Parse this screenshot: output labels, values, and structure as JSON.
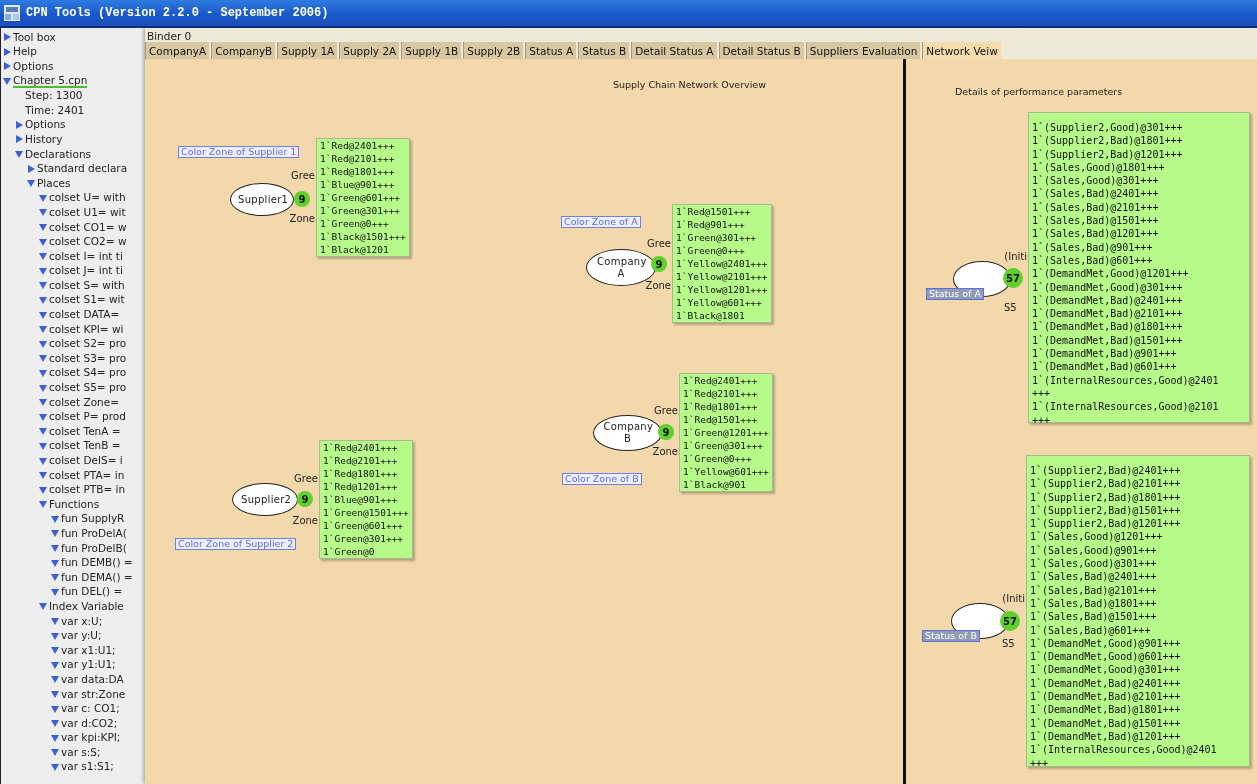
{
  "window": {
    "title": "CPN Tools (Version 2.2.0 - September 2006)"
  },
  "sidebar": {
    "items": [
      {
        "label": "Tool box",
        "expanded": false,
        "selected": false
      },
      {
        "label": "Help",
        "expanded": false,
        "selected": false
      },
      {
        "label": "Options",
        "expanded": false,
        "selected": false
      },
      {
        "label": "Chapter 5.cpn",
        "expanded": true,
        "selected": true,
        "children": [
          {
            "label": "Step: 1300"
          },
          {
            "label": "Time: 2401"
          },
          {
            "label": "Options",
            "expanded": false
          },
          {
            "label": "History",
            "expanded": false
          },
          {
            "label": "Declarations",
            "expanded": true,
            "children": [
              {
                "label": "Standard declara",
                "expanded": false
              },
              {
                "label": "Places",
                "expanded": true,
                "children": [
                  {
                    "label": "colset U= with",
                    "expanded": true
                  },
                  {
                    "label": "colset U1= wit",
                    "expanded": true
                  },
                  {
                    "label": "colset CO1= w",
                    "expanded": true
                  },
                  {
                    "label": "colset CO2= w",
                    "expanded": true
                  },
                  {
                    "label": "colset I= int ti",
                    "expanded": true
                  },
                  {
                    "label": "colset J= int ti",
                    "expanded": true
                  },
                  {
                    "label": "colset S= with",
                    "expanded": true
                  },
                  {
                    "label": "colset S1= wit",
                    "expanded": true
                  },
                  {
                    "label": "colset DATA=",
                    "expanded": true
                  },
                  {
                    "label": "colset KPI= wi",
                    "expanded": true
                  },
                  {
                    "label": "colset S2= pro",
                    "expanded": true
                  },
                  {
                    "label": "colset S3= pro",
                    "expanded": true
                  },
                  {
                    "label": "colset S4= pro",
                    "expanded": true
                  },
                  {
                    "label": "colset S5= pro",
                    "expanded": true
                  },
                  {
                    "label": "colset Zone=",
                    "expanded": true
                  },
                  {
                    "label": "colset P= prod",
                    "expanded": true
                  },
                  {
                    "label": "colset TenA =",
                    "expanded": true
                  },
                  {
                    "label": "colset TenB =",
                    "expanded": true
                  },
                  {
                    "label": "colset DelS= i",
                    "expanded": true
                  },
                  {
                    "label": "colset PTA= in",
                    "expanded": true
                  },
                  {
                    "label": "colset PTB= in",
                    "expanded": true
                  },
                  {
                    "label": "Functions",
                    "expanded": true,
                    "children": [
                      {
                        "label": "fun SupplyR",
                        "expanded": true
                      },
                      {
                        "label": "fun ProDelA(",
                        "expanded": true
                      },
                      {
                        "label": "fun ProDelB(",
                        "expanded": true
                      },
                      {
                        "label": "fun DEMB() =",
                        "expanded": true
                      },
                      {
                        "label": "fun DEMA() =",
                        "expanded": true
                      },
                      {
                        "label": "fun DEL() =",
                        "expanded": true
                      }
                    ]
                  },
                  {
                    "label": "Index Variable",
                    "expanded": true,
                    "children": [
                      {
                        "label": "var x:U;",
                        "expanded": true
                      },
                      {
                        "label": "var y:U;",
                        "expanded": true
                      },
                      {
                        "label": "var x1:U1;",
                        "expanded": true
                      },
                      {
                        "label": "var y1:U1;",
                        "expanded": true
                      },
                      {
                        "label": "var data:DA",
                        "expanded": true
                      },
                      {
                        "label": "var str:Zone",
                        "expanded": true
                      },
                      {
                        "label": "var c: CO1;",
                        "expanded": true
                      },
                      {
                        "label": "var d:CO2;",
                        "expanded": true
                      },
                      {
                        "label": "var kpi:KPI;",
                        "expanded": true
                      },
                      {
                        "label": "var s:S;",
                        "expanded": true
                      },
                      {
                        "label": "var s1:S1;",
                        "expanded": true
                      }
                    ]
                  }
                ]
              }
            ]
          }
        ]
      }
    ]
  },
  "binder": {
    "title": "Binder 0"
  },
  "tabs": [
    {
      "label": "CompanyA",
      "selected": false
    },
    {
      "label": "CompanyB",
      "selected": false
    },
    {
      "label": "Supply 1A",
      "selected": false
    },
    {
      "label": "Supply 2A",
      "selected": false
    },
    {
      "label": "Supply 1B",
      "selected": false
    },
    {
      "label": "Supply 2B",
      "selected": false
    },
    {
      "label": "Status A",
      "selected": false
    },
    {
      "label": "Status B",
      "selected": false
    },
    {
      "label": "Detail Status A",
      "selected": false
    },
    {
      "label": "Detail Status B",
      "selected": false
    },
    {
      "label": "Suppliers Evaluation",
      "selected": false
    },
    {
      "label": "Network Veiw",
      "selected": true
    }
  ],
  "pages": [
    {
      "title": "Supply Chain Network Overview"
    },
    {
      "title": "Details of performance parameters"
    }
  ],
  "places": [
    {
      "kind": "zone",
      "name": "Supplier1",
      "tokens": "9",
      "label": "Color Zone of Supplier 1",
      "inscription_top": "Gree",
      "inscription_bottom": "Zone",
      "marking": [
        "1`Red@2401+++",
        "1`Red@2101+++",
        "1`Red@1801+++",
        "1`Blue@901+++",
        "1`Green@601+++",
        "1`Green@301+++",
        "1`Green@0+++",
        "1`Black@1501+++",
        "1`Black@1201"
      ]
    },
    {
      "kind": "zone",
      "name": "Supplier2",
      "tokens": "9",
      "label": "Color Zone of Supplier 2",
      "inscription_top": "Gree",
      "inscription_bottom": "Zone",
      "marking": [
        "1`Red@2401+++",
        "1`Red@2101+++",
        "1`Red@1801+++",
        "1`Red@1201+++",
        "1`Blue@901+++",
        "1`Green@1501+++",
        "1`Green@601+++",
        "1`Green@301+++",
        "1`Green@0"
      ]
    },
    {
      "kind": "zone",
      "name": "Company A",
      "tokens": "9",
      "label": "Color Zone of A",
      "inscription_top": "Gree",
      "inscription_bottom": "Zone",
      "marking": [
        "1`Red@1501+++",
        "1`Red@901+++",
        "1`Green@301+++",
        "1`Green@0+++",
        "1`Yellow@2401+++",
        "1`Yellow@2101+++",
        "1`Yellow@1201+++",
        "1`Yellow@601+++",
        "1`Black@1801"
      ]
    },
    {
      "kind": "zone",
      "name": "Company B",
      "tokens": "9",
      "label": "Color Zone of B",
      "inscription_top": "Gree",
      "inscription_bottom": "Zone",
      "marking": [
        "1`Red@2401+++",
        "1`Red@2101+++",
        "1`Red@1801+++",
        "1`Red@1501+++",
        "1`Green@1201+++",
        "1`Green@301+++",
        "1`Green@0+++",
        "1`Yellow@601+++",
        "1`Black@901"
      ]
    },
    {
      "kind": "status",
      "tokens": "57",
      "label": "Status of A",
      "inscription_top": "(Initi",
      "inscription_bottom": "S5",
      "marking": [
        "1`(Supplier2,Good)@301+++",
        "1`(Supplier2,Bad)@1801+++",
        "1`(Supplier2,Bad)@1201+++",
        "1`(Sales,Good)@1801+++",
        "1`(Sales,Good)@301+++",
        "1`(Sales,Bad)@2401+++",
        "1`(Sales,Bad)@2101+++",
        "1`(Sales,Bad)@1501+++",
        "1`(Sales,Bad)@1201+++",
        "1`(Sales,Bad)@901+++",
        "1`(Sales,Bad)@601+++",
        "1`(DemandMet,Good)@1201+++",
        "1`(DemandMet,Good)@301+++",
        "1`(DemandMet,Bad)@2401+++",
        "1`(DemandMet,Bad)@2101+++",
        "1`(DemandMet,Bad)@1801+++",
        "1`(DemandMet,Bad)@1501+++",
        "1`(DemandMet,Bad)@901+++",
        "1`(DemandMet,Bad)@601+++",
        "1`(InternalResources,Good)@2401",
        "+++",
        "1`(InternalResources,Good)@2101",
        "+++"
      ]
    },
    {
      "kind": "status",
      "tokens": "57",
      "label": "Status of B",
      "inscription_top": "(Initi",
      "inscription_bottom": "S5",
      "marking": [
        "1`(Supplier2,Bad)@2401+++",
        "1`(Supplier2,Bad)@2101+++",
        "1`(Supplier2,Bad)@1801+++",
        "1`(Supplier2,Bad)@1501+++",
        "1`(Supplier2,Bad)@1201+++",
        "1`(Sales,Good)@1201+++",
        "1`(Sales,Good)@901+++",
        "1`(Sales,Good)@301+++",
        "1`(Sales,Bad)@2401+++",
        "1`(Sales,Bad)@2101+++",
        "1`(Sales,Bad)@1801+++",
        "1`(Sales,Bad)@1501+++",
        "1`(Sales,Bad)@601+++",
        "1`(DemandMet,Good)@901+++",
        "1`(DemandMet,Good)@601+++",
        "1`(DemandMet,Good)@301+++",
        "1`(DemandMet,Bad)@2401+++",
        "1`(DemandMet,Bad)@2101+++",
        "1`(DemandMet,Bad)@1801+++",
        "1`(DemandMet,Bad)@1501+++",
        "1`(DemandMet,Bad)@1201+++",
        "1`(InternalResources,Good)@2401",
        "+++"
      ]
    }
  ]
}
